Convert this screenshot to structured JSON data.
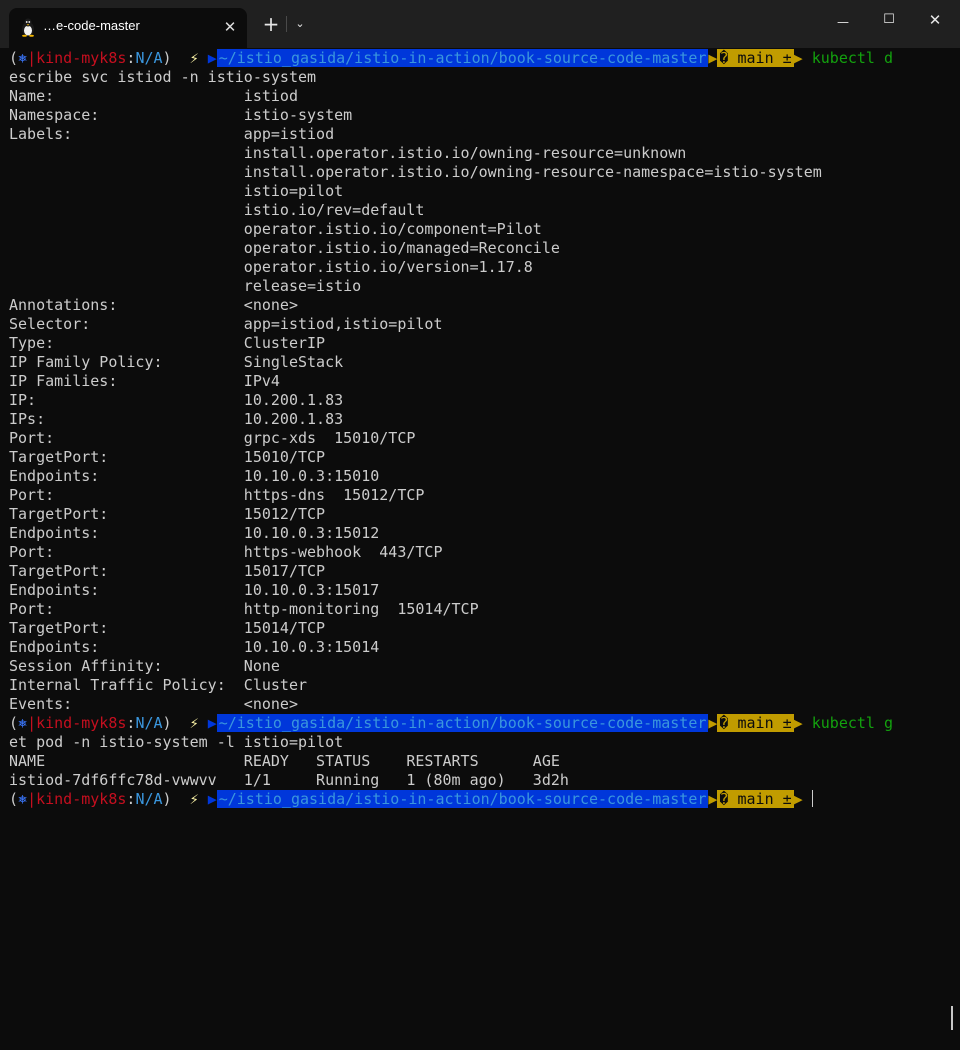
{
  "window": {
    "tab_title": "…e-code-master",
    "tab_icon": "linux-tux-icon",
    "tab_close": "✕",
    "new_tab": "+",
    "dropdown": "⌄",
    "minimize": "—",
    "maximize": "☐",
    "close": "✕"
  },
  "colors": {
    "background": "#0c0c0c",
    "text": "#cccccc",
    "dir_segment": "#0037da",
    "git_segment": "#c19c00",
    "context": "#c50f1f",
    "command": "#13a10e"
  },
  "prompt": {
    "open": "(",
    "k8s_icon": "⎈",
    "bar": "|",
    "context": "kind-myk8s",
    "colon": ":",
    "namespace": "N/A",
    "close": ")",
    "bolt": "⚡",
    "path": "~/istio_gasida/istio-in-action/book-source-code-master",
    "branch": "� main ±",
    "arrow": "▶"
  },
  "commands": [
    {
      "first": "kubectl d",
      "wrap": "escribe svc istiod -n istio-system"
    },
    {
      "first": "kubectl g",
      "wrap": "et pod -n istio-system -l istio=pilot"
    }
  ],
  "describe_output": [
    "Name:                     istiod",
    "Namespace:                istio-system",
    "Labels:                   app=istiod",
    "                          install.operator.istio.io/owning-resource=unknown",
    "                          install.operator.istio.io/owning-resource-namespace=istio-system",
    "                          istio=pilot",
    "                          istio.io/rev=default",
    "                          operator.istio.io/component=Pilot",
    "                          operator.istio.io/managed=Reconcile",
    "                          operator.istio.io/version=1.17.8",
    "                          release=istio",
    "Annotations:              <none>",
    "Selector:                 app=istiod,istio=pilot",
    "Type:                     ClusterIP",
    "IP Family Policy:         SingleStack",
    "IP Families:              IPv4",
    "IP:                       10.200.1.83",
    "IPs:                      10.200.1.83",
    "Port:                     grpc-xds  15010/TCP",
    "TargetPort:               15010/TCP",
    "Endpoints:                10.10.0.3:15010",
    "Port:                     https-dns  15012/TCP",
    "TargetPort:               15012/TCP",
    "Endpoints:                10.10.0.3:15012",
    "Port:                     https-webhook  443/TCP",
    "TargetPort:               15017/TCP",
    "Endpoints:                10.10.0.3:15017",
    "Port:                     http-monitoring  15014/TCP",
    "TargetPort:               15014/TCP",
    "Endpoints:                10.10.0.3:15014",
    "Session Affinity:         None",
    "Internal Traffic Policy:  Cluster",
    "Events:                   <none>"
  ],
  "pod_output": [
    "NAME                      READY   STATUS    RESTARTS      AGE",
    "istiod-7df6ffc78d-vwwvv   1/1     Running   1 (80m ago)   3d2h"
  ]
}
